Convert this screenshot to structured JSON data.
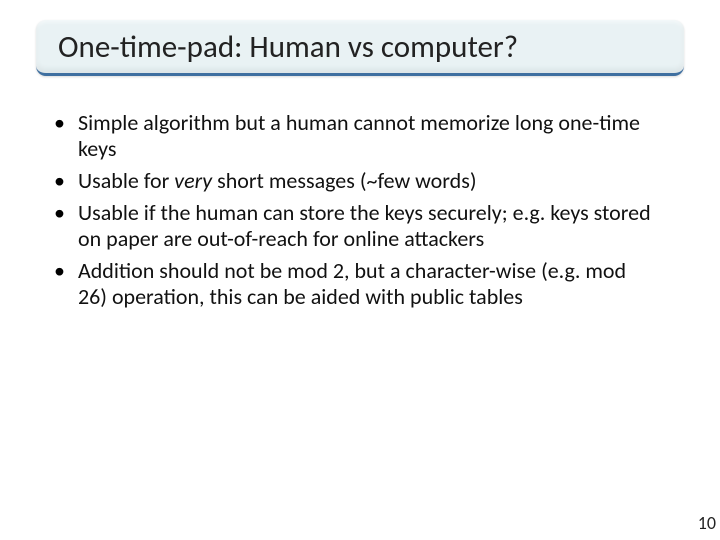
{
  "slide": {
    "title": "One-time-pad: Human vs computer?",
    "bullets": [
      {
        "pre": "Simple algorithm but a human cannot memorize long one-time keys",
        "em": "",
        "post": ""
      },
      {
        "pre": "Usable for ",
        "em": "very",
        "post": " short messages (~few words)"
      },
      {
        "pre": "Usable if the human can store the keys securely; e.g. keys stored on paper are out-of-reach for online attackers",
        "em": "",
        "post": ""
      },
      {
        "pre": "Addition should not be mod 2, but a character-wise (e.g. mod 26) operation, this can be aided with public tables",
        "em": "",
        "post": ""
      }
    ],
    "page_number": "10"
  }
}
